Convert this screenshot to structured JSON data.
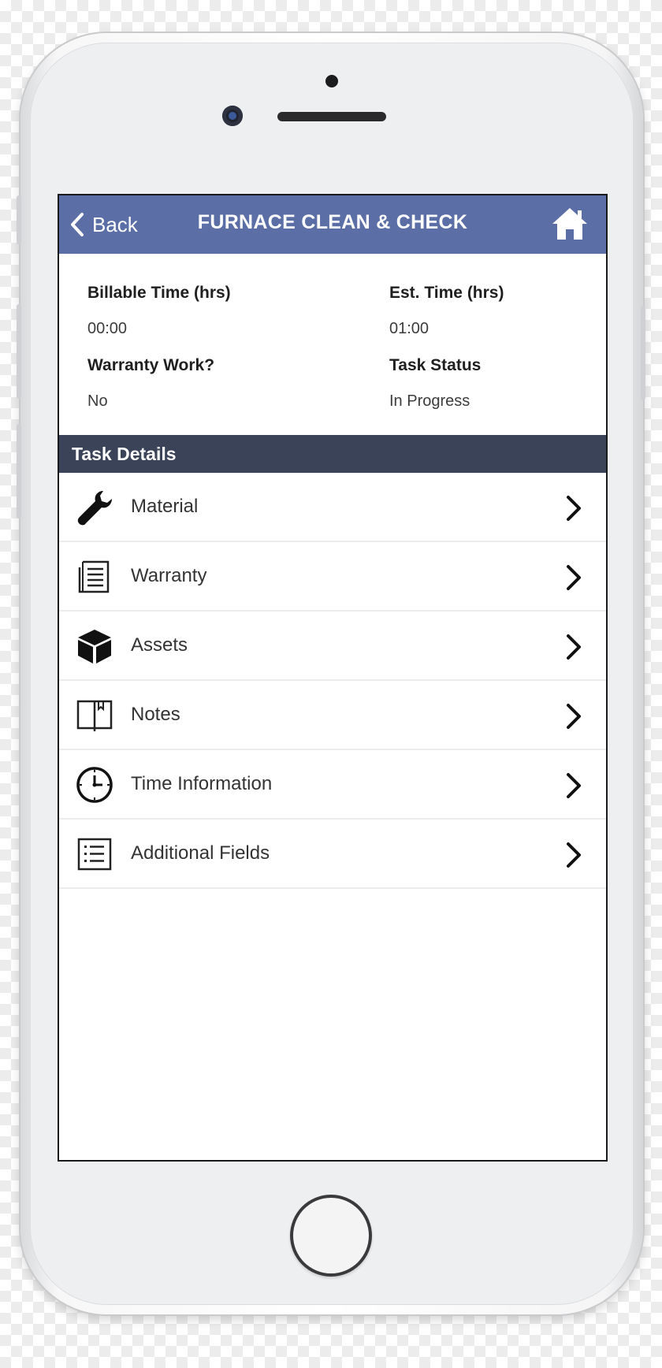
{
  "colors": {
    "navbar": "#5b6ea6",
    "section_header": "#3b4358",
    "phone_body": "#f5f5f6"
  },
  "navbar": {
    "back_label": "Back",
    "title": "FURNACE CLEAN & CHECK",
    "back_icon": "chevron-left-icon",
    "home_icon": "home-icon"
  },
  "summary": {
    "billable_time": {
      "label": "Billable Time (hrs)",
      "value": "00:00"
    },
    "est_time": {
      "label": "Est. Time (hrs)",
      "value": "01:00"
    },
    "warranty_work": {
      "label": "Warranty Work?",
      "value": "No"
    },
    "task_status": {
      "label": "Task Status",
      "value": "In Progress"
    }
  },
  "task_details": {
    "header": "Task Details",
    "items": [
      {
        "label": "Material",
        "icon": "wrench-icon"
      },
      {
        "label": "Warranty",
        "icon": "document-icon"
      },
      {
        "label": "Assets",
        "icon": "cube-icon"
      },
      {
        "label": "Notes",
        "icon": "notebook-icon"
      },
      {
        "label": "Time Information",
        "icon": "clock-icon"
      },
      {
        "label": "Additional Fields",
        "icon": "list-icon"
      }
    ]
  }
}
